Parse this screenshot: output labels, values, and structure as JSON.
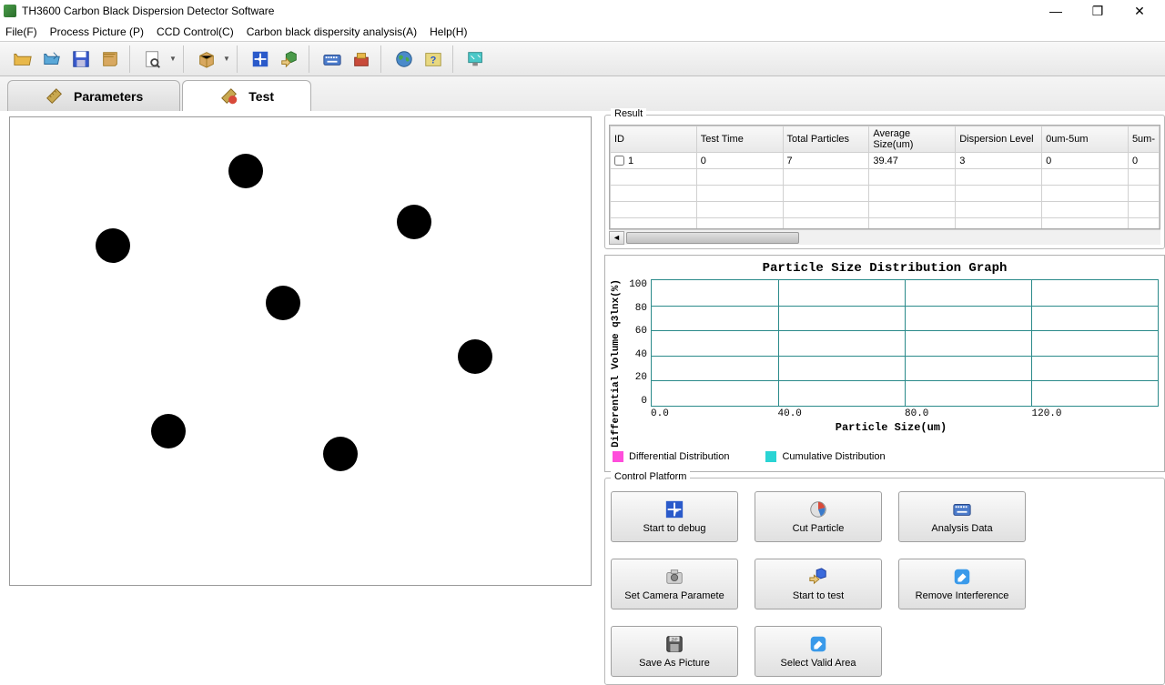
{
  "app": {
    "title": "TH3600 Carbon Black Dispersion Detector Software"
  },
  "menu": {
    "file": "File(F)",
    "process": "Process Picture (P)",
    "ccd": "CCD Control(C)",
    "analysis": "Carbon black dispersity analysis(A)",
    "help": "Help(H)"
  },
  "tabs": {
    "parameters": "Parameters",
    "test": "Test"
  },
  "result": {
    "legend": "Result",
    "headers": [
      "ID",
      "Test Time",
      "Total Particles",
      "Average Size(um)",
      "Dispersion Level",
      "0um-5um",
      "5um-"
    ],
    "row": {
      "id": "1",
      "test_time": "0",
      "total_particles": "7",
      "avg_size": "39.47",
      "dispersion": "3",
      "r0_5": "0",
      "r5_": "0"
    }
  },
  "chart_data": {
    "type": "bar",
    "title": "Particle Size Distribution Graph",
    "xlabel": "Particle Size(um)",
    "ylabel": "Differential Volume q3lnx(%)",
    "y_ticks": [
      "100",
      "80",
      "60",
      "40",
      "20",
      "0"
    ],
    "x_ticks": [
      "0.0",
      "40.0",
      "80.0",
      "120.0"
    ],
    "series": [
      {
        "name": "Differential Distribution",
        "color": "#ff4ddb",
        "values": []
      },
      {
        "name": "Cumulative Distribution",
        "color": "#2ad4d4",
        "values": []
      }
    ],
    "ylim": [
      0,
      100
    ],
    "xlim": [
      0,
      160
    ]
  },
  "control": {
    "legend": "Control Platform",
    "buttons": {
      "debug": "Start to debug",
      "cut": "Cut Particle",
      "analysis": "Analysis Data",
      "camera": "Set Camera Paramete",
      "test": "Start to test",
      "remove": "Remove Interference",
      "save": "Save As Picture",
      "select": "Select Valid Area"
    }
  }
}
